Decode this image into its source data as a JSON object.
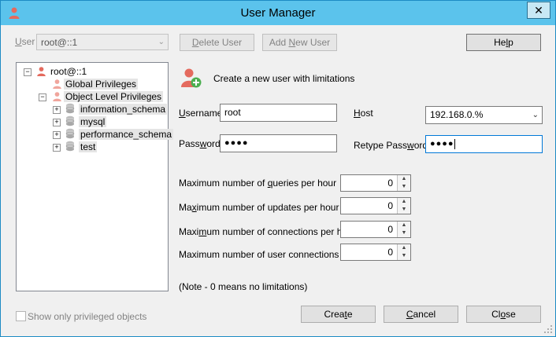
{
  "window": {
    "title": "User Manager",
    "close_glyph": "✕"
  },
  "top": {
    "user_label": "User",
    "user_value": "root@::1",
    "delete_user": "Delete User",
    "add_new_user": "Add New User",
    "help": "Help"
  },
  "tree": {
    "root": "root@::1",
    "global": "Global Privileges",
    "object_level": "Object Level Privileges",
    "databases": [
      "information_schema",
      "mysql",
      "performance_schema",
      "test"
    ]
  },
  "header": {
    "description": "Create a new user with limitations",
    "icon": "add-user-icon"
  },
  "form": {
    "username_label": "Username",
    "username_value": "root",
    "host_label": "Host",
    "host_value": "192.168.0.%",
    "password_label": "Password",
    "password_value": "●●●●",
    "retype_label": "Retype Password",
    "retype_value": "●●●●"
  },
  "limits": [
    {
      "label": "Maximum number of queries per hour",
      "value": "0"
    },
    {
      "label": "Maximum number of updates per hour",
      "value": "0"
    },
    {
      "label": "Maximum number of connections per hour",
      "value": "0"
    },
    {
      "label": "Maximum number of user connections",
      "value": "0"
    }
  ],
  "note": "(Note - 0 means no limitations)",
  "footer": {
    "show_only_privileged": "Show only privileged objects",
    "create": "Create",
    "cancel": "Cancel",
    "close": "Close"
  },
  "colors": {
    "titlebar": "#5bc3ec",
    "accent": "#0078d7"
  }
}
